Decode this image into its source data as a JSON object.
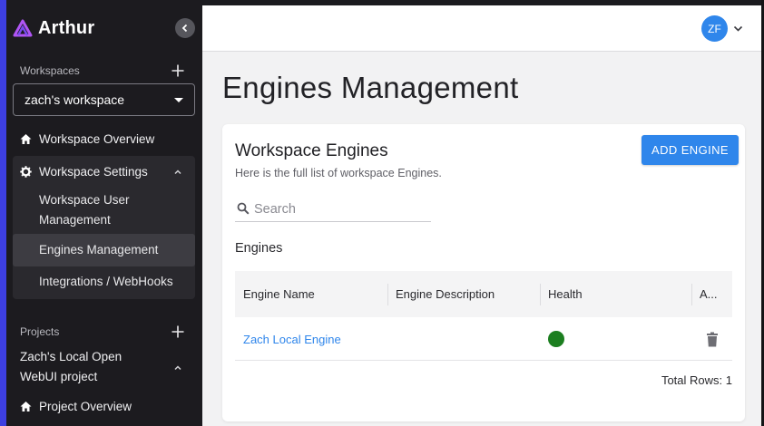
{
  "brand": {
    "name": "Arthur"
  },
  "sidebar": {
    "workspaces_label": "Workspaces",
    "workspace_select": {
      "value": "zach's workspace"
    },
    "items": [
      {
        "label": "Workspace Overview",
        "icon": "home-icon"
      },
      {
        "label": "Workspace Settings",
        "icon": "gear-icon",
        "expanded": true
      }
    ],
    "settings_subitems": [
      {
        "label": "Workspace User Management",
        "active": false
      },
      {
        "label": "Engines Management",
        "active": true
      },
      {
        "label": "Integrations / WebHooks",
        "active": false
      }
    ],
    "projects_label": "Projects",
    "project": {
      "label": "Zach's Local Open WebUI project",
      "expanded": true
    },
    "project_items": [
      {
        "label": "Project Overview",
        "icon": "home-icon"
      }
    ]
  },
  "topbar": {
    "avatar_initials": "ZF"
  },
  "page": {
    "title": "Engines Management"
  },
  "card": {
    "title": "Workspace Engines",
    "subtitle": "Here is the full list of workspace Engines.",
    "add_button": "ADD ENGINE",
    "search_placeholder": "Search",
    "table_label": "Engines",
    "columns": [
      "Engine Name",
      "Engine Description",
      "Health",
      "A..."
    ],
    "rows": [
      {
        "name": "Zach Local Engine",
        "description": "",
        "health": "healthy"
      }
    ],
    "total_rows": "Total Rows: 1"
  },
  "colors": {
    "accent": "#2f86eb",
    "sidebar_bg": "#1c1b1f",
    "brand_purple": "#a050f0",
    "health_ok": "#1b7e1f"
  }
}
